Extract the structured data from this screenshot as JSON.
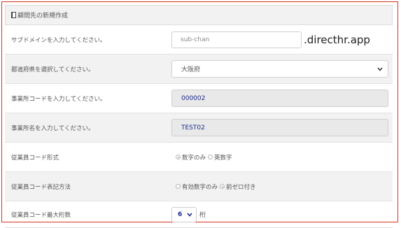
{
  "header": {
    "title": "顧問先の新規作成",
    "icon": "book-icon"
  },
  "rows": [
    {
      "label": "サブドメインを入力してください。",
      "placeholder": "sub-chan",
      "suffix": ".directhr.app"
    },
    {
      "label": "都道府県を選択してください。",
      "selected": "大阪府"
    },
    {
      "label": "事業所コードを入力してください。",
      "value": "000002"
    },
    {
      "label": "事業所名を入力してください。",
      "value": "TEST02"
    },
    {
      "label": "従業員コード形式",
      "options": [
        "数字のみ",
        "英数字"
      ],
      "checked": "数字のみ"
    },
    {
      "label": "従業員コード表記方法",
      "options": [
        "有効数字のみ",
        "前ゼロ付き"
      ],
      "checked": "前ゼロ付き"
    },
    {
      "label": "従業員コード最大桁数",
      "selected": "6",
      "unit": "桁"
    }
  ],
  "colors": {
    "border_accent": "#d93025",
    "readonly_text": "#1a2a8c"
  }
}
